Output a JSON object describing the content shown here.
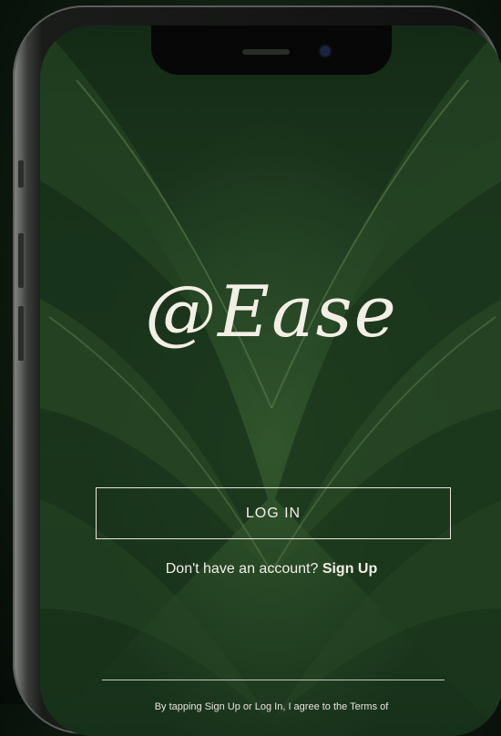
{
  "app": {
    "logo_text": "@Ease"
  },
  "auth": {
    "login_label": "LOG IN",
    "no_account_text": "Don't have an account?",
    "signup_label": "Sign Up",
    "terms_text": "By tapping Sign Up or Log In, I agree to the Terms of"
  },
  "colors": {
    "text": "#f2efe7",
    "background_leaf": "#1d3a1f"
  }
}
